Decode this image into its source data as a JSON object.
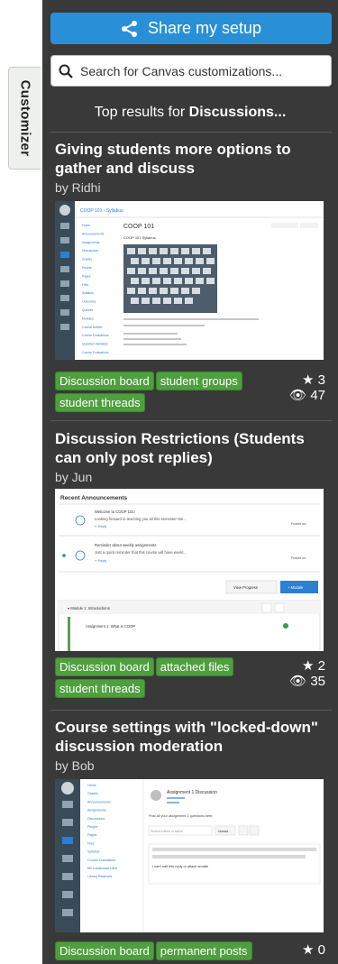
{
  "tab": {
    "label": "Customizer"
  },
  "panel": {
    "share_label": "Share my setup",
    "search_placeholder": "Search for Canvas customizations...",
    "results_prefix": "Top results for ",
    "results_term": "Discussions..."
  },
  "cards": [
    {
      "title": "Giving students more options to gather and discuss",
      "author": "by Ridhi",
      "tags": [
        "Discussion board",
        "student groups",
        "student threads"
      ],
      "stars": "3",
      "views": "47"
    },
    {
      "title": "Discussion Restrictions (Students can only post replies)",
      "author": "by Jun",
      "tags": [
        "Discussion board",
        "attached files",
        "student threads"
      ],
      "stars": "2",
      "views": "35"
    },
    {
      "title": "Course settings with \"locked-down\" discussion moderation",
      "author": "by Bob",
      "tags": [
        "Discussion board",
        "permanent posts"
      ],
      "stars": "0",
      "views": ""
    }
  ],
  "thumb1": {
    "crumb": "COOP 101 › Syllabus",
    "heading": "COOP 101",
    "sub": "COOP 101 Syllabus",
    "nav": [
      "Home",
      "Announcements",
      "Assignments",
      "Discussions",
      "Grades",
      "People",
      "Pages",
      "Files",
      "Syllabus",
      "Outcomes",
      "Quizzes",
      "Modules",
      "Course Notifier",
      "Course Evaluations",
      "Question Validation",
      "Course Evaluations"
    ],
    "rail": [
      "Account",
      "Dashboard",
      "Courses",
      "Groups",
      "Calendar",
      "Inbox",
      "Commons",
      "Help"
    ]
  },
  "thumb2": {
    "header": "Recent Announcements",
    "a1_title": "Welcome to COOP 101!",
    "a1_body": "Looking forward to teaching you all this semester! Be...",
    "a2_title": "Reminder about weekly assignments",
    "a2_body": "Just a quick reminder that this course will have weekl...",
    "reply": "↩ Reply",
    "posted": "Posted on:",
    "view_progress": "View Progress",
    "module_btn": "+ Module",
    "module_title": "▾ Module 1: Introductions",
    "assignment": "Assignment 1: What is COOP"
  },
  "thumb3": {
    "nav": [
      "Home",
      "Grades",
      "Announcements",
      "Assignments",
      "Discussions",
      "People",
      "Pages",
      "Files",
      "Syllabus",
      "Course Evaluations",
      "BB Collaborate Ultra",
      "Library Reserves"
    ],
    "rail": [
      "Account",
      "Dashboard",
      "Courses",
      "Calendar",
      "Inbox",
      "Commons",
      "Help"
    ],
    "post_title": "Assignment 1 Discussion",
    "post_prompt": "Post all your assignment 1 questions here.",
    "search_ph": "Search entries or author",
    "unread": "Unread",
    "reply_text": "I can't edit this reply or attach emails!"
  },
  "colors": {
    "share": "#2990d7",
    "tag": "#4f9f3f",
    "panel": "#393939"
  }
}
